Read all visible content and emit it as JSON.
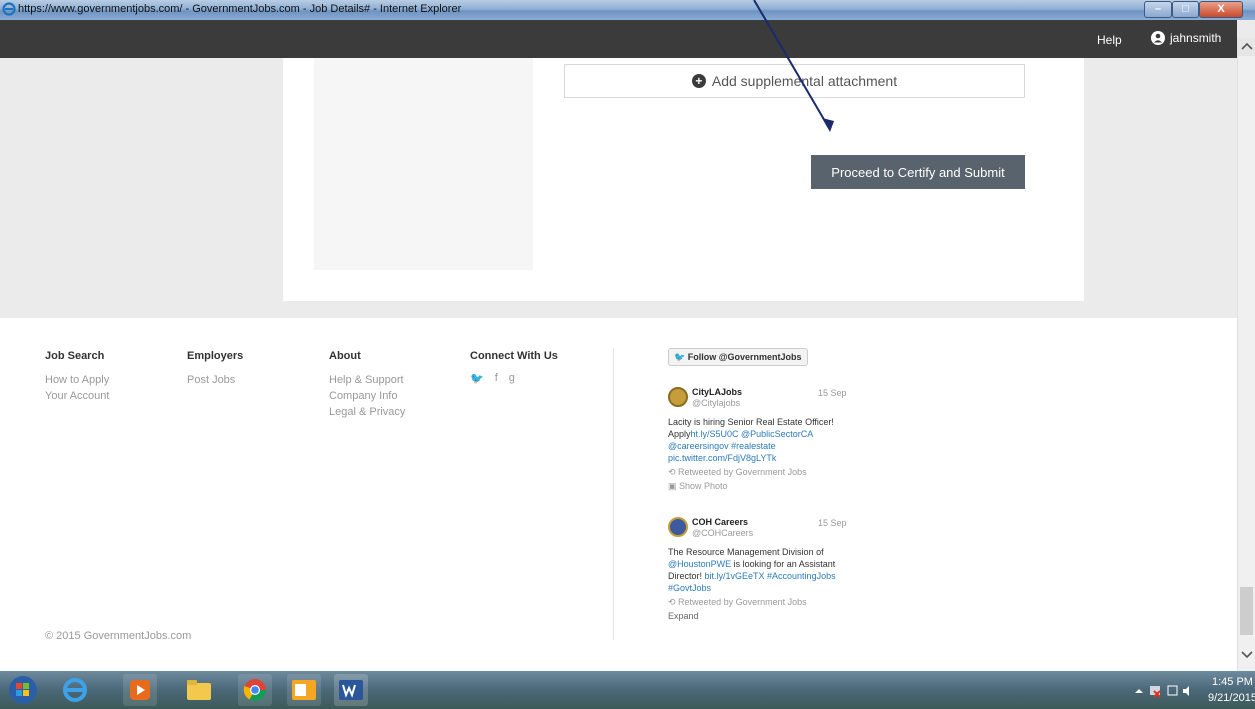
{
  "window": {
    "title": "https://www.governmentjobs.com/ - GovernmentJobs.com - Job Details# - Internet Explorer",
    "minimize": "–",
    "maximize": "□",
    "close": "X"
  },
  "navbar": {
    "help": "Help",
    "user": "jahnsmith"
  },
  "main": {
    "attach_label": "Add supplemental attachment",
    "submit_label": "Proceed to Certify and Submit"
  },
  "footer": {
    "job_search": {
      "heading": "Job Search",
      "links": [
        "How to Apply",
        "Your Account"
      ]
    },
    "employers": {
      "heading": "Employers",
      "links": [
        "Post Jobs"
      ]
    },
    "about": {
      "heading": "About",
      "links": [
        "Help & Support",
        "Company Info",
        "Legal & Privacy"
      ]
    },
    "connect": {
      "heading": "Connect With Us",
      "icons": [
        "twitter-icon",
        "facebook-icon",
        "google-plus-icon"
      ],
      "glyphs": [
        "🐦",
        "f",
        "g"
      ]
    },
    "copyright": "© 2015 GovernmentJobs.com",
    "follow_label": "Follow @GovernmentJobs",
    "tweets": [
      {
        "name": "CityLAJobs",
        "handle": "@Citylajobs",
        "date": "15 Sep",
        "text": "Lacity is hiring Senior Real Estate Officer! Apply",
        "links": "ht.ly/S5U0C @PublicSectorCA @careersingov #realestate pic.twitter.com/FdjV8gLYTk",
        "retweet": "Retweeted by Government Jobs",
        "action": "Show Photo"
      },
      {
        "name": "COH Careers",
        "handle": "@COHCareers",
        "date": "15 Sep",
        "text": "The Resource Management Division of ",
        "link1": "@HoustonPWE",
        "text2": " is looking for an Assistant Director! ",
        "links": "bit.ly/1vGEeTX #AccountingJobs #GovtJobs",
        "retweet": "Retweeted by Government Jobs",
        "action": "Expand"
      }
    ]
  },
  "taskbar": {
    "time": "1:45 PM",
    "date": "9/21/2015"
  },
  "colors": {
    "navbar": "#3b3b3b",
    "submit": "#59636d",
    "link": "#2b7bb9",
    "arrow": "#1a2a6c"
  }
}
